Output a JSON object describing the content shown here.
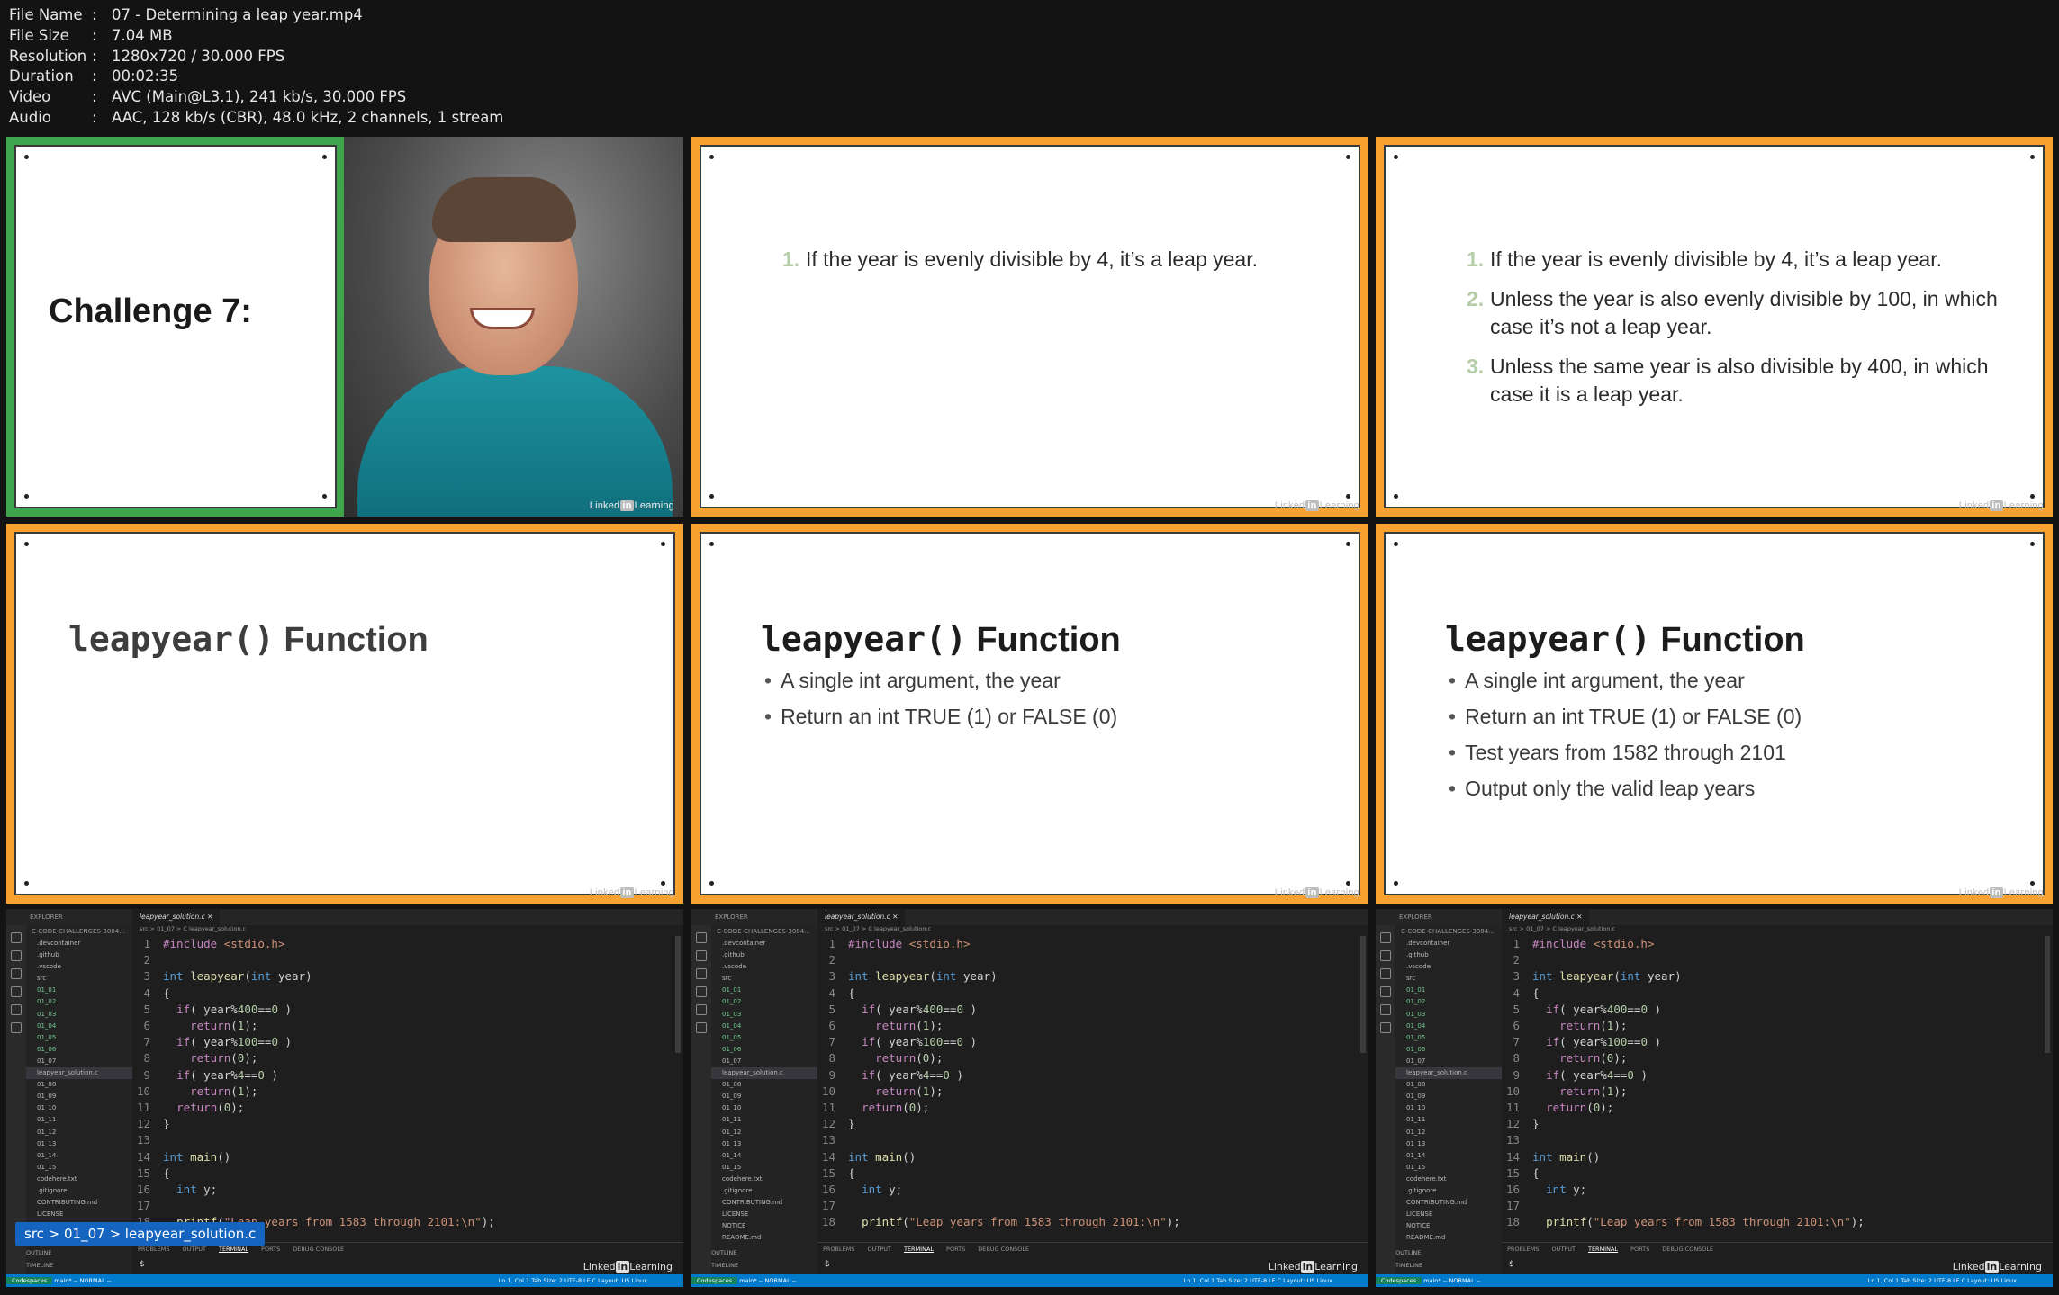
{
  "meta": [
    {
      "key": "File Name",
      "value": "07 - Determining a leap year.mp4"
    },
    {
      "key": "File Size",
      "value": "7.04 MB"
    },
    {
      "key": "Resolution",
      "value": "1280x720 / 30.000 FPS"
    },
    {
      "key": "Duration",
      "value": "00:02:35"
    },
    {
      "key": "Video",
      "value": "AVC (Main@L3.1), 241 kb/s, 30.000 FPS"
    },
    {
      "key": "Audio",
      "value": "AAC, 128 kb/s (CBR), 48.0 kHz, 2 channels, 1 stream"
    }
  ],
  "brand": {
    "a": "Linked",
    "b": "in",
    "c": "Learning"
  },
  "slide1": {
    "title": "Challenge 7:"
  },
  "rules": [
    {
      "n": "1.",
      "text": "If the year is evenly divisible by 4, it’s a leap year."
    },
    {
      "n": "2.",
      "text": "Unless the year is also evenly divisible by 100, in which case it’s not a leap year."
    },
    {
      "n": "3.",
      "text": "Unless the same year is also divisible by 400, in which case it is a leap year."
    }
  ],
  "fn": {
    "mono": "leapyear()",
    "sans": " Function"
  },
  "bullets": [
    "A single int argument, the year",
    "Return an int TRUE (1) or FALSE (0)",
    "Test years from 1582 through 2101",
    "Output only the valid leap years"
  ],
  "editor": {
    "explorer": "EXPLORER",
    "root": "C-CODE-CHALLENGES-3084...",
    "tab": "leapyear_solution.c",
    "crumb": "src > 01_07 > C leapyear_solution.c",
    "files": [
      ".devcontainer",
      ".github",
      ".vscode",
      "src",
      "01_01",
      "01_02",
      "01_03",
      "01_04",
      "01_05",
      "01_06",
      "01_07",
      "leapyear_solution.c",
      "01_08",
      "01_09",
      "01_10",
      "01_11",
      "01_12",
      "01_13",
      "01_14",
      "01_15",
      "codehere.txt",
      ".gitignore",
      "CONTRIBUTING.md",
      "LICENSE",
      "NOTICE",
      "README.md"
    ],
    "panel_tabs": [
      "PROBLEMS",
      "OUTPUT",
      "TERMINAL",
      "PORTS",
      "DEBUG CONSOLE"
    ],
    "outline": "OUTLINE",
    "timeline": "TIMELINE",
    "prompt": "$",
    "status_left": "Codespaces",
    "status_branch": "main*",
    "status_mode": "-- NORMAL --",
    "status_right": "Ln 1, Col 1   Tab Size: 2   UTF-8   LF   C   Layout: US   Linux",
    "tooltip": "src > 01_07 > leapyear_solution.c",
    "line_numbers": [
      "1",
      "2",
      "3",
      "4",
      "5",
      "6",
      "7",
      "8",
      "9",
      "10",
      "11",
      "12",
      "13",
      "14",
      "15",
      "16",
      "17",
      "18"
    ]
  }
}
